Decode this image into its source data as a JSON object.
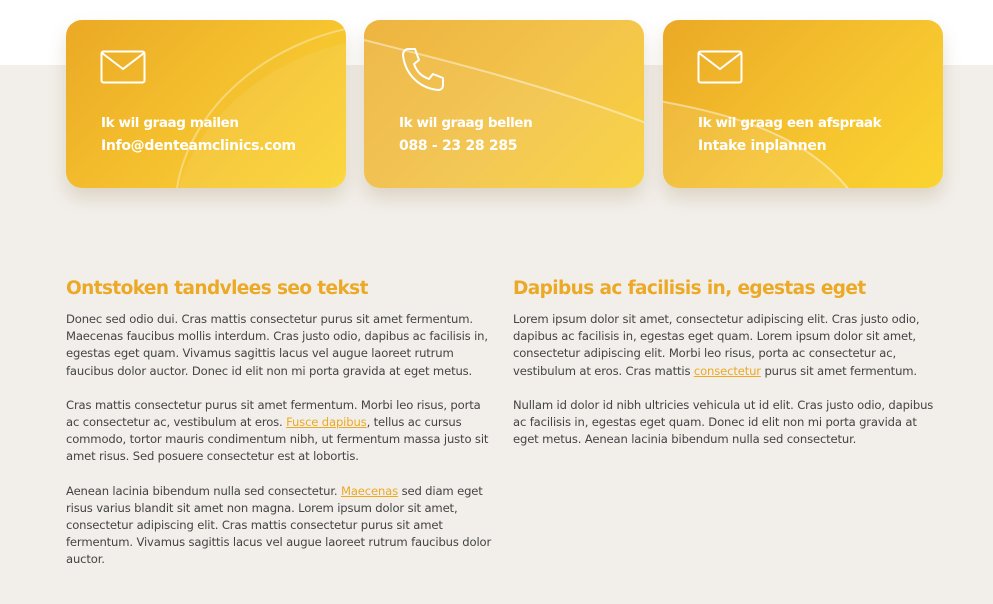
{
  "cards": [
    {
      "icon": "mail-icon",
      "label": "Ik wil graag mailen",
      "value": "Info@denteamclinics.com"
    },
    {
      "icon": "phone-icon",
      "label": "Ik wil graag bellen",
      "value": "088 - 23 28 285"
    },
    {
      "icon": "mail-icon",
      "label": "Ik wil graag een afspraak",
      "value": "Intake inplannen"
    }
  ],
  "left": {
    "heading": "Ontstoken tandvlees seo tekst",
    "p1": "Donec sed odio dui. Cras mattis consectetur purus sit amet fermentum. Maecenas faucibus mollis interdum. Cras justo odio, dapibus ac facilisis in, egestas eget quam. Vivamus sagittis lacus vel augue laoreet rutrum faucibus dolor auctor. Donec id elit non mi porta gravida at eget metus.",
    "p2_before": "Cras mattis consectetur purus sit amet fermentum. Morbi leo risus, porta ac consectetur ac, vestibulum at eros. ",
    "p2_link": "Fusce dapibus",
    "p2_after": ", tellus ac cursus commodo, tortor mauris condimentum nibh, ut fermentum massa justo sit amet risus. Sed posuere consectetur est at lobortis.",
    "p3_before": "Aenean lacinia bibendum nulla sed consectetur. ",
    "p3_link": "Maecenas",
    "p3_after": " sed diam eget risus varius blandit sit amet non magna. Lorem ipsum dolor sit amet, consectetur adipiscing elit. Cras mattis consectetur purus sit amet fermentum. Vivamus sagittis lacus vel augue laoreet rutrum faucibus dolor auctor."
  },
  "right": {
    "heading": "Dapibus ac facilisis in, egestas eget",
    "p1_before": "Lorem ipsum dolor sit amet, consectetur adipiscing elit. Cras justo odio, dapibus ac facilisis in, egestas eget quam. Lorem ipsum dolor sit amet, consectetur adipiscing elit. Morbi leo risus, porta ac consectetur ac, vestibulum at eros. Cras mattis ",
    "p1_link": "consectetur",
    "p1_after": " purus sit amet fermentum.",
    "p2": "Nullam id dolor id nibh ultricies vehicula ut id elit. Cras justo odio, dapibus ac facilisis in, egestas eget quam. Donec id elit non mi porta gravida at eget metus. Aenean lacinia bibendum nulla sed consectetur."
  },
  "colors": {
    "accent": "#eba925",
    "card_gradient_start": "#eba925",
    "card_gradient_end": "#fbd42f",
    "band_background": "#f2efea",
    "body_text": "#444444"
  }
}
